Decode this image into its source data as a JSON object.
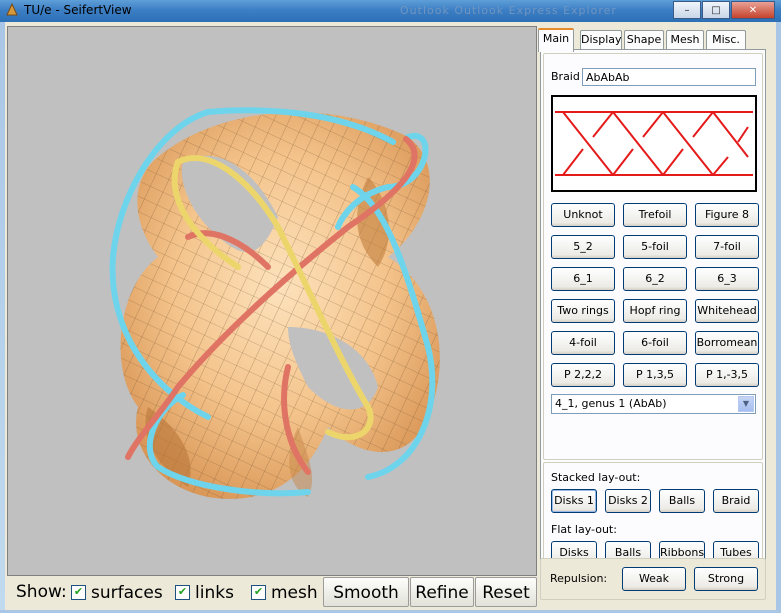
{
  "window": {
    "title": "TU/e - SeifertView",
    "background_text": "Outlook  Outlook Express  Explorer",
    "buttons": {
      "minimize": "–",
      "maximize": "□",
      "close": "✕"
    }
  },
  "bottom_bar": {
    "show_label": "Show:",
    "checkboxes": [
      {
        "label": "surfaces",
        "checked": true
      },
      {
        "label": "links",
        "checked": true
      },
      {
        "label": "mesh",
        "checked": true
      }
    ],
    "smooth": "Smooth",
    "refine": "Refine",
    "reset": "Reset"
  },
  "tabs": [
    {
      "label": "Main",
      "active": true
    },
    {
      "label": "Display"
    },
    {
      "label": "Shape"
    },
    {
      "label": "Mesh"
    },
    {
      "label": "Misc."
    }
  ],
  "main": {
    "braid_label": "Braid",
    "braid_value": "AbAbAb",
    "knot_buttons": [
      [
        "Unknot",
        "Trefoil",
        "Figure 8"
      ],
      [
        "5_2",
        "5-foil",
        "7-foil"
      ],
      [
        "6_1",
        "6_2",
        "6_3"
      ],
      [
        "Two rings",
        "Hopf ring",
        "Whitehead"
      ],
      [
        "4-foil",
        "6-foil",
        "Borromean"
      ],
      [
        "P 2,2,2",
        "P 1,3,5",
        "P 1,-3,5"
      ]
    ],
    "knot_select": "4_1, genus 1 (AbAb)",
    "stacked_label": "Stacked lay-out:",
    "stacked_buttons": [
      "Disks 1",
      "Disks 2",
      "Balls",
      "Braid"
    ],
    "flat_label": "Flat lay-out:",
    "flat_buttons": [
      "Disks",
      "Balls",
      "Ribbons",
      "Tubes"
    ],
    "repulsion_label": "Repulsion:",
    "repulsion_buttons": [
      "Weak",
      "Strong"
    ]
  },
  "colors": {
    "surface": "#f4c48c",
    "link_cyan": "#6ed4ec",
    "link_red": "#e07464",
    "link_yellow": "#ecd66c",
    "braid_line": "#e51a1a",
    "viewport_bg": "#c0c0c0"
  }
}
